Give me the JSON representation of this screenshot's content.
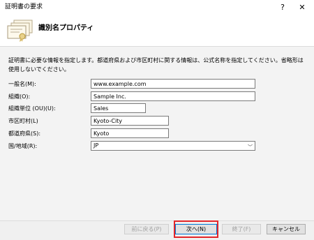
{
  "window": {
    "title": "証明書の要求",
    "help_label": "?",
    "close_label": "✕"
  },
  "header": {
    "title": "識別名プロパティ",
    "icon": "certificate-icon"
  },
  "description": "証明書に必要な情報を指定します。都道府県および市区町村に関する情報は、公式名称を指定してください。省略形は使用しないでください。",
  "form": {
    "common_name": {
      "label": "一般名(M):",
      "value": "www.example.com"
    },
    "organization": {
      "label": "組織(O):",
      "value": "Sample Inc."
    },
    "organizational_unit": {
      "label": "組織単位 (OU)(U):",
      "value": "Sales"
    },
    "locality": {
      "label": "市区町村(L)",
      "value": "Kyoto-City"
    },
    "state": {
      "label": "都道府県(S):",
      "value": "Kyoto"
    },
    "country": {
      "label": "国/地域(R):",
      "value": "JP",
      "chevron": "﹀"
    }
  },
  "footer": {
    "back_label": "前に戻る(P)",
    "next_label": "次へ(N)",
    "finish_label": "終了(F)",
    "cancel_label": "キャンセル"
  },
  "colors": {
    "content_bg": "#f3f3f3",
    "highlight": "#e3262a"
  }
}
